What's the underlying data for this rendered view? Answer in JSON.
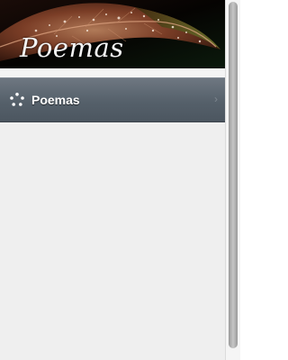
{
  "banner": {
    "title": "Poemas"
  },
  "nav": {
    "items": [
      {
        "label": "Poemas",
        "icon": "loading-dots-icon"
      }
    ]
  }
}
